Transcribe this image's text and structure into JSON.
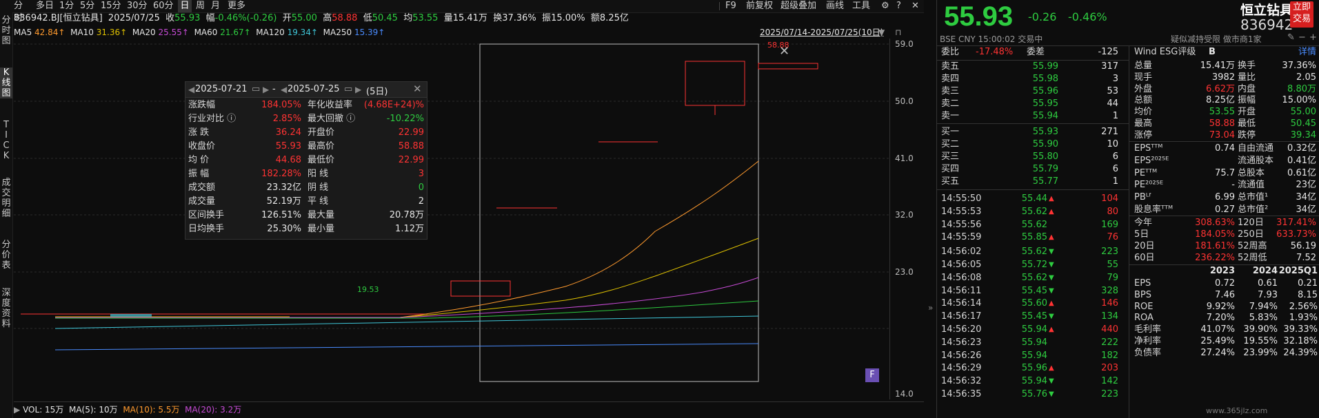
{
  "topbar": {
    "tabs": [
      "分时",
      "多日",
      "1分",
      "5分",
      "15分",
      "30分",
      "60分",
      "日",
      "周",
      "月",
      "更多"
    ],
    "active": "日",
    "right": [
      "F9",
      "前复权",
      "超级叠加",
      "画线",
      "工具"
    ]
  },
  "leftnav": [
    {
      "label": "分\n时\n图"
    },
    {
      "label": "K\n线\n图",
      "active": true
    },
    {
      "label": "T\nI\nC\nK"
    },
    {
      "label": "成\n交\n明\n细"
    },
    {
      "label": "分\n价\n表"
    },
    {
      "label": "深\n度\n资\n料"
    }
  ],
  "info": {
    "stock": "836942.BJ[恒立钻具]",
    "date": "2025/07/25",
    "close_label": "收",
    "close": "55.93",
    "chg_label": "幅",
    "chg": "-0.46%(-0.26)",
    "open_label": "开",
    "open": "55.00",
    "high_label": "高",
    "high": "58.88",
    "low_label": "低",
    "low": "50.45",
    "avg_label": "均",
    "avg": "53.55",
    "vol_label": "量",
    "vol": "15.41万",
    "turn_label": "换",
    "turn": "37.36%",
    "amp_label": "振",
    "amp": "15.00%",
    "amt_label": "额",
    "amt": "8.25亿"
  },
  "ma": {
    "ma5": "MA5",
    "ma5v": "42.84↑",
    "ma10": "MA10",
    "ma10v": "31.36↑",
    "ma20": "MA20",
    "ma20v": "25.55↑",
    "ma60": "MA60",
    "ma60v": "21.67↑",
    "ma120": "MA120",
    "ma120v": "19.34↑",
    "ma250": "MA250",
    "ma250v": "15.39↑",
    "range": "2025/07/14-2025/07/25(10日)"
  },
  "yaxis": [
    "59.0",
    "50.0",
    "41.0",
    "32.0",
    "23.0",
    "14.0"
  ],
  "low_marker": "19.53",
  "high_marker": "58.88",
  "statbox": {
    "from": "2025-07-21",
    "to": "2025-07-25",
    "dash": "-",
    "days": "(5日)",
    "rows": [
      {
        "k": "涨跌幅",
        "v": "184.05%",
        "vc": "red",
        "k2": "年化收益率",
        "v2": "(4.68E+24)%",
        "v2c": "red"
      },
      {
        "k": "行业对比 ⓘ",
        "v": "2.85%",
        "vc": "red",
        "k2": "最大回撤 ⓘ",
        "v2": "-10.22%",
        "v2c": "green"
      },
      {
        "k": "涨  跌",
        "v": "36.24",
        "vc": "red",
        "k2": "开盘价",
        "v2": "22.99",
        "v2c": "red"
      },
      {
        "k": "收盘价",
        "v": "55.93",
        "vc": "red",
        "k2": "最高价",
        "v2": "58.88",
        "v2c": "red"
      },
      {
        "k": "均  价",
        "v": "44.68",
        "vc": "red",
        "k2": "最低价",
        "v2": "22.99",
        "v2c": "red"
      },
      {
        "k": "振  幅",
        "v": "182.28%",
        "vc": "red",
        "k2": "阳  线",
        "v2": "3",
        "v2c": "red"
      },
      {
        "k": "成交额",
        "v": "23.32亿",
        "vc": "white",
        "k2": "阴  线",
        "v2": "0",
        "v2c": "green"
      },
      {
        "k": "成交量",
        "v": "52.19万",
        "vc": "white",
        "k2": "平  线",
        "v2": "2",
        "v2c": "white"
      },
      {
        "k": "区间换手",
        "v": "126.51%",
        "vc": "white",
        "k2": "最大量",
        "v2": "20.78万",
        "v2c": "white"
      },
      {
        "k": "日均换手",
        "v": "25.30%",
        "vc": "white",
        "k2": "最小量",
        "v2": "1.12万",
        "v2c": "white"
      }
    ]
  },
  "volline": {
    "vol": "VOL: 15万",
    "ma5": "MA(5): 10万",
    "ma10": "MA(10): 5.5万",
    "ma20": "MA(20): 3.2万"
  },
  "f_badge": "F",
  "right": {
    "price": "55.93",
    "chg": "-0.26",
    "pct": "-0.46%",
    "name": "恒立钻具",
    "code": "836942",
    "trade_btn": "立即\n交易",
    "sub": "BSE  CNY  15:00:02  交易中",
    "sub2": "疑似减持受限  做市商1家",
    "ratio": {
      "k": "委比",
      "v": "-17.48%",
      "k2": "委差",
      "v2": "-125"
    },
    "asks": [
      {
        "n": "卖五",
        "p": "55.99",
        "q": "317"
      },
      {
        "n": "卖四",
        "p": "55.98",
        "q": "3"
      },
      {
        "n": "卖三",
        "p": "55.96",
        "q": "53"
      },
      {
        "n": "卖二",
        "p": "55.95",
        "q": "44"
      },
      {
        "n": "卖一",
        "p": "55.94",
        "q": "1"
      }
    ],
    "bids": [
      {
        "n": "买一",
        "p": "55.93",
        "q": "271"
      },
      {
        "n": "买二",
        "p": "55.90",
        "q": "10"
      },
      {
        "n": "买三",
        "p": "55.80",
        "q": "6"
      },
      {
        "n": "买四",
        "p": "55.79",
        "q": "6"
      },
      {
        "n": "买五",
        "p": "55.77",
        "q": "1"
      }
    ],
    "ticks": [
      {
        "t": "14:55:50",
        "p": "55.44",
        "d": "up",
        "q": "104"
      },
      {
        "t": "14:55:53",
        "p": "55.62",
        "d": "up",
        "q": "80"
      },
      {
        "t": "14:55:56",
        "p": "55.62",
        "d": "",
        "q": "169"
      },
      {
        "t": "14:55:59",
        "p": "55.85",
        "d": "up",
        "q": "76"
      },
      {
        "t": "14:56:02",
        "p": "55.62",
        "d": "down",
        "q": "223"
      },
      {
        "t": "14:56:05",
        "p": "55.72",
        "d": "down",
        "q": "55"
      },
      {
        "t": "14:56:08",
        "p": "55.62",
        "d": "down",
        "q": "79"
      },
      {
        "t": "14:56:11",
        "p": "55.45",
        "d": "down",
        "q": "328"
      },
      {
        "t": "14:56:14",
        "p": "55.60",
        "d": "up",
        "q": "146"
      },
      {
        "t": "14:56:17",
        "p": "55.45",
        "d": "down",
        "q": "134"
      },
      {
        "t": "14:56:20",
        "p": "55.94",
        "d": "up",
        "q": "440"
      },
      {
        "t": "14:56:23",
        "p": "55.94",
        "d": "",
        "q": "222"
      },
      {
        "t": "14:56:26",
        "p": "55.94",
        "d": "",
        "q": "182"
      },
      {
        "t": "14:56:29",
        "p": "55.96",
        "d": "up",
        "q": "203"
      },
      {
        "t": "14:56:32",
        "p": "55.94",
        "d": "down",
        "q": "142"
      },
      {
        "t": "14:56:35",
        "p": "55.76",
        "d": "down",
        "q": "223"
      }
    ],
    "fund_header": {
      "k": "Wind ESG评级",
      "v": "B",
      "link": "详情"
    },
    "fund1": [
      {
        "k": "总量",
        "v": "15.41万",
        "vc": "white",
        "k2": "换手",
        "v2": "37.36%",
        "v2c": "white"
      },
      {
        "k": "现手",
        "v": "3982",
        "vc": "white",
        "k2": "量比",
        "v2": "2.05",
        "v2c": "white"
      },
      {
        "k": "外盘",
        "v": "6.62万",
        "vc": "red",
        "k2": "内盘",
        "v2": "8.80万",
        "v2c": "green"
      },
      {
        "k": "总额",
        "v": "8.25亿",
        "vc": "white",
        "k2": "振幅",
        "v2": "15.00%",
        "v2c": "white"
      },
      {
        "k": "均价",
        "v": "53.55",
        "vc": "green",
        "k2": "开盘",
        "v2": "55.00",
        "v2c": "green"
      },
      {
        "k": "最高",
        "v": "58.88",
        "vc": "red",
        "k2": "最低",
        "v2": "50.45",
        "v2c": "green"
      },
      {
        "k": "涨停",
        "v": "73.04",
        "vc": "red",
        "k2": "跌停",
        "v2": "39.34",
        "v2c": "green"
      }
    ],
    "fund2": [
      {
        "k": "EPSᵀᵀᴹ",
        "v": "0.74",
        "vc": "white",
        "k2": "自由流通",
        "v2": "0.32亿",
        "v2c": "white"
      },
      {
        "k": "EPS²⁰²⁵ᴱ",
        "v": "",
        "vc": "white",
        "k2": "流通股本",
        "v2": "0.41亿",
        "v2c": "white"
      },
      {
        "k": "PEᵀᵀᴹ",
        "v": "75.7",
        "vc": "white",
        "k2": "总股本",
        "v2": "0.61亿",
        "v2c": "white"
      },
      {
        "k": "PE²⁰²⁵ᴱ",
        "v": "-",
        "vc": "white",
        "k2": "流通值",
        "v2": "23亿",
        "v2c": "white"
      },
      {
        "k": "PBᴸᶠ",
        "v": "6.99",
        "vc": "white",
        "k2": "总市值¹",
        "v2": "34亿",
        "v2c": "white"
      },
      {
        "k": "股息率ᵀᵀᴹ",
        "v": "0.27",
        "vc": "white",
        "k2": "总市值²",
        "v2": "34亿",
        "v2c": "white"
      }
    ],
    "fund3": [
      {
        "k": "今年",
        "v": "308.63%",
        "vc": "red",
        "k2": "120日",
        "v2": "317.41%",
        "v2c": "red"
      },
      {
        "k": "5日",
        "v": "184.05%",
        "vc": "red",
        "k2": "250日",
        "v2": "633.73%",
        "v2c": "red"
      },
      {
        "k": "20日",
        "v": "181.61%",
        "vc": "red",
        "k2": "52周高",
        "v2": "56.19",
        "v2c": "white"
      },
      {
        "k": "60日",
        "v": "236.22%",
        "vc": "red",
        "k2": "52周低",
        "v2": "7.52",
        "v2c": "white"
      }
    ],
    "years": {
      "h": [
        "2023",
        "2024",
        "2025Q1"
      ],
      "rows": [
        {
          "k": "EPS",
          "c": [
            "0.72",
            "0.61",
            "0.21"
          ]
        },
        {
          "k": "BPS",
          "c": [
            "7.46",
            "7.93",
            "8.15"
          ]
        },
        {
          "k": "ROE",
          "c": [
            "9.92%",
            "7.94%",
            "2.56%"
          ]
        },
        {
          "k": "ROA",
          "c": [
            "7.20%",
            "5.83%",
            "1.93%"
          ]
        },
        {
          "k": "毛利率",
          "c": [
            "41.07%",
            "39.90%",
            "39.33%"
          ]
        },
        {
          "k": "净利率",
          "c": [
            "25.49%",
            "19.55%",
            "32.18%"
          ]
        },
        {
          "k": "负债率",
          "c": [
            "27.24%",
            "23.99%",
            "24.39%"
          ]
        }
      ]
    },
    "watermark": "www.365jlz.com"
  }
}
